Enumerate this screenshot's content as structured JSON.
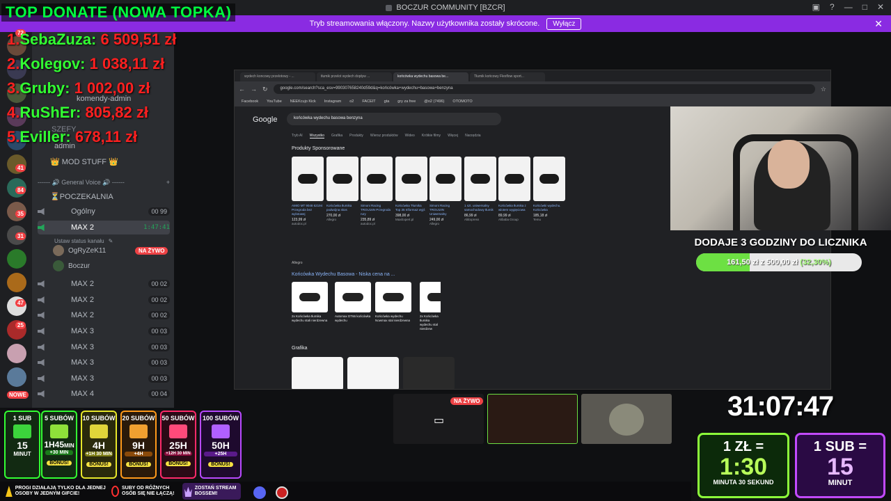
{
  "window": {
    "title": "BOCZUR COMMUNITY [BZCR]"
  },
  "streamer_mode": {
    "message": "Tryb streamowania włączony. Nazwy użytkownika zostały skrócone.",
    "button": "Wyłącz"
  },
  "top_donate": {
    "title": "TOP DONATE (NOWA TOPKA)",
    "entries": [
      {
        "rank": "1.",
        "name": "SebaZuza:",
        "amount": "6 509,51 zł"
      },
      {
        "rank": "2.",
        "name": "Kolegov:",
        "amount": "1 038,11 zł"
      },
      {
        "rank": "3.",
        "name": "Gruby:",
        "amount": "1 002,00 zł"
      },
      {
        "rank": "4.",
        "name": "RuShEr:",
        "amount": "805,82 zł"
      },
      {
        "rank": "5.",
        "name": "Eviller:",
        "amount": "678,11 zł"
      }
    ]
  },
  "server_badges": [
    "72",
    "41",
    "84",
    "35",
    "31",
    "47",
    "25",
    "NOWE"
  ],
  "channels": {
    "partial_items": [
      "komendy-admin",
      "SZEFY",
      "admin"
    ],
    "mod_stuff": "👑 MOD STUFF 👑",
    "voice_category": "------ 🔊 General Voice 🔊 ------",
    "waiting_room": "⏳POCZEKALNIA",
    "voice": [
      {
        "name": "Ogólny",
        "count": "00 99"
      },
      {
        "name": "MAX 2",
        "timer": "1:47:41"
      },
      {
        "name": "MAX 2",
        "count": "00 02"
      },
      {
        "name": "MAX 2",
        "count": "00 02"
      },
      {
        "name": "MAX 2",
        "count": "00 02"
      },
      {
        "name": "MAX 3",
        "count": "00 03"
      },
      {
        "name": "MAX 3",
        "count": "00 03"
      },
      {
        "name": "MAX 3",
        "count": "00 03"
      },
      {
        "name": "MAX 3",
        "count": "00 03"
      },
      {
        "name": "MAX 4",
        "count": "00 04"
      }
    ],
    "status_prompt": "Ustaw status kanału",
    "users": [
      {
        "name": "OgRyZeK11",
        "live": "NA ŻYWO"
      },
      {
        "name": "Boczur"
      }
    ]
  },
  "browser": {
    "tabs": [
      "wydech koncowy przelotowy - ...",
      "tłumik przelot wydech dopływ ...",
      "końcówka wydechu basowa be...",
      "Tłumik końcowy Flexflow sport..."
    ],
    "url": "google.com/search?sca_esv=990307658240d59d&q=końcówka+wydechu+basowa+benzyna",
    "bookmarks": [
      "Facebook",
      "YouTube",
      "NEEKcujo Kick",
      "Instagram",
      "o2",
      "FACEIT",
      "gta",
      "gry za free",
      "@o2 (7496)",
      "OTOMOTO"
    ],
    "google_logo": "Google",
    "query": "końcówka wydechu basowa benzyna",
    "filters": [
      "Tryb AI",
      "Wszystko",
      "Grafika",
      "Produkty",
      "Wiersz produktów",
      "Wideo",
      "Krótkie filmy",
      "Więcej",
      "Narzędzia"
    ],
    "sponsored_heading": "Produkty Sponsorowane",
    "products": [
      {
        "title": "AMIO MT 9048 62194 Przegroda bez wylotowej",
        "price": "123,99 zł",
        "shop": "autodoc.pl"
      },
      {
        "title": "Końcówka tłumika podwójna skos",
        "price": "270,00 zł",
        "shop": "Allegro"
      },
      {
        "title": "Simoni Racing TROU16N Przegroda rury",
        "price": "235,89 zł",
        "shop": "autodoc.pl"
      },
      {
        "title": "Końcówka Tłumika Top 35 Iriforma2 wyjś",
        "price": "398,00 zł",
        "shop": "MaxExpert.pl"
      },
      {
        "title": "Simoni Racing TROU10N Uniwersalny",
        "price": "249,00 zł",
        "shop": "Allegro"
      },
      {
        "title": "1 szt. uniwersalny samochodowy tłumik",
        "price": "86,99 zł",
        "shop": "AliExpress"
      },
      {
        "title": "Końcówka tłumika z wlotem wygięciowa",
        "price": "89,99 zł",
        "shop": "Alibaba Group"
      },
      {
        "title": "Końcówki wydechu. Końcówka",
        "price": "185,18 zł",
        "shop": "Temu"
      }
    ],
    "allegro_source": "Allegro",
    "allegro_heading": "Końcówka Wydechu Basowa - Niska cena na ...",
    "allegro_items": [
      "2x Końcówka tłumika wydechu stali nierdzewna",
      "Automax DT66 końcówka wydechu",
      "Końcówka wydechu Nowmax stal nierdzewna",
      "2x Końcówka tłumika wydechu stal nierdzew"
    ],
    "images_heading": "Grafika"
  },
  "goal": {
    "title": "DODAJE 3 GODZINY DO LICZNIKA",
    "current": "161,50 zł",
    "sep": "z",
    "target": "500,00 zł",
    "percent_text": "(32,30%)",
    "progress": 0.323
  },
  "previews": {
    "live": "NA ŻYWO"
  },
  "timer": "31:07:47",
  "sub_goals": [
    {
      "head": "1 SUB",
      "value": "15",
      "unit": "MINUT",
      "color": "#33ff33",
      "gift": "#3cd43c"
    },
    {
      "head": "5 SUBÓW",
      "value": "1H45",
      "unit": "MIN",
      "extra": "+30 MIN",
      "bonus": "BONUS!",
      "color": "#33ff33",
      "gift": "#8ee03a"
    },
    {
      "head": "10 SUBÓW",
      "value": "4H",
      "extra": "+1H 30 MIN",
      "bonus": "BONUS!",
      "color": "#e8e82a",
      "gift": "#e0d43a"
    },
    {
      "head": "20 SUBÓW",
      "value": "9H",
      "extra": "+4H",
      "bonus": "BONUS!",
      "color": "#ff9a1a",
      "gift": "#f0a030"
    },
    {
      "head": "50 SUBÓW",
      "value": "25H",
      "extra": "+12H 30 MIN",
      "bonus": "BONUS!",
      "color": "#ff2a6a",
      "gift": "#ff4a7a"
    },
    {
      "head": "100 SUBÓW",
      "value": "50H",
      "extra": "+25H",
      "bonus": "BONUS!",
      "color": "#b84aff",
      "gift": "#b060ff"
    }
  ],
  "info_bar": [
    {
      "text": "PROGI DZIAŁAJĄ TYLKO DLA JEDNEJ OSOBY W JEDNYM GIFCIE!",
      "icon": "warning-icon"
    },
    {
      "text": "SUBY OD RÓŻNYCH OSÓB SIĘ NIE ŁĄCZĄ!",
      "icon": "no-icon"
    },
    {
      "text": "ZOSTAŃ STREAM BOSSEM!",
      "icon": "crown-icon"
    }
  ],
  "rates": [
    {
      "head": "1 ZŁ =",
      "value": "1:30",
      "unit": "MINUTA 30 SEKUND",
      "color": "#8dff3a"
    },
    {
      "head": "1 SUB =",
      "value": "15",
      "unit": "MINUT",
      "color": "#c24aff"
    }
  ]
}
